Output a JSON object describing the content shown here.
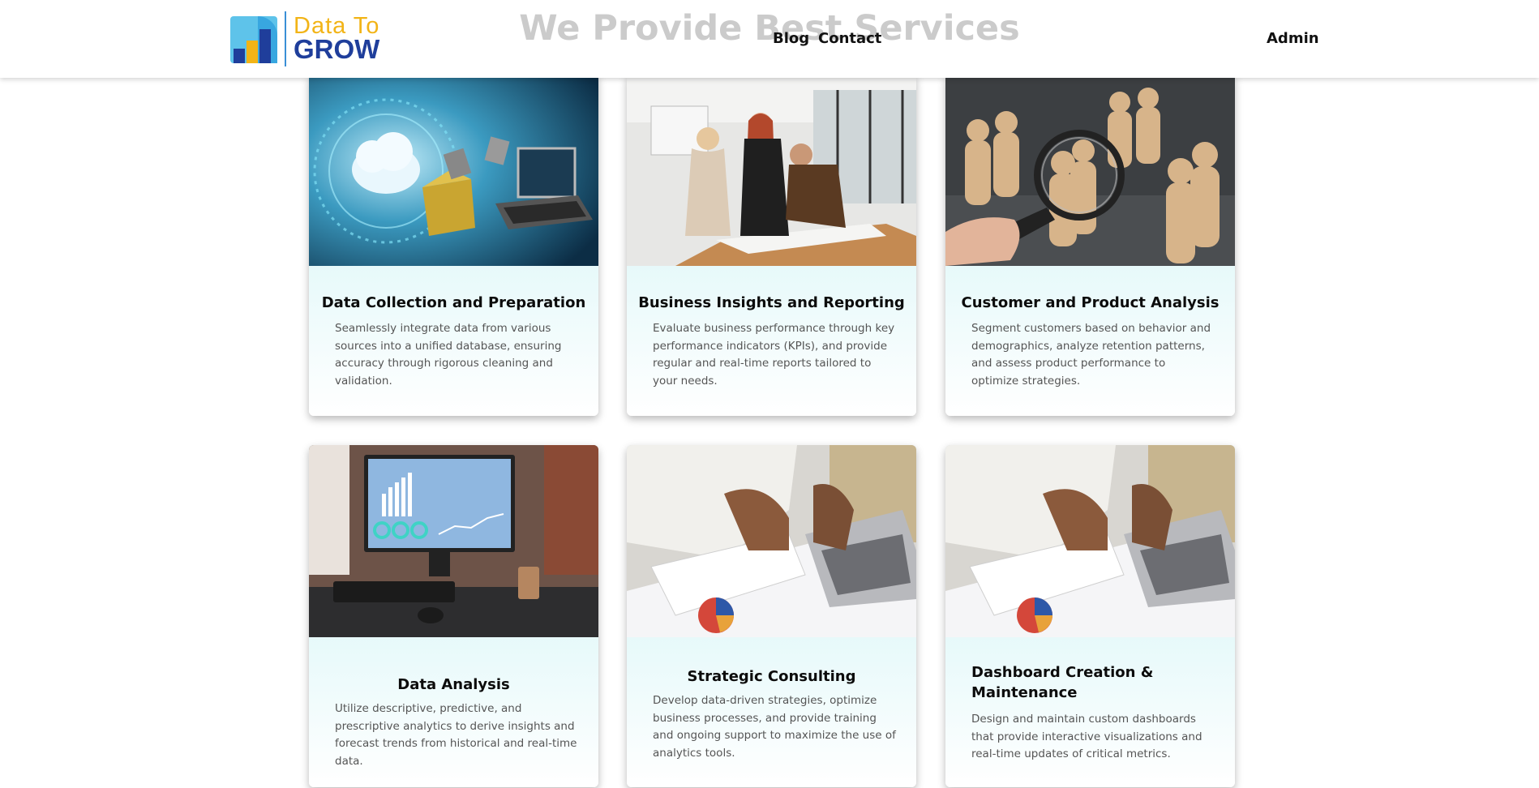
{
  "header": {
    "logo": {
      "line1": "Data To",
      "line2": "GROW"
    },
    "section_title": "We Provide Best Services",
    "nav": {
      "blog": "Blog",
      "contact": "Contact",
      "admin": "Admin"
    }
  },
  "services": [
    {
      "title": "Data Collection and Preparation",
      "description": "Seamlessly integrate data from various sources into a unified database, ensuring accuracy through rigorous cleaning and validation.",
      "image": "cloud-data-transfer-image"
    },
    {
      "title": "Business Insights and Reporting",
      "description": "Evaluate business performance through key performance indicators (KPIs), and provide regular and real-time reports tailored to your needs.",
      "image": "team-meeting-image"
    },
    {
      "title": "Customer and Product Analysis",
      "description": "Segment customers based on behavior and demographics, analyze retention patterns, and assess product performance to optimize strategies.",
      "image": "magnifier-figures-image"
    },
    {
      "title": "Data Analysis",
      "description": "Utilize descriptive, predictive, and prescriptive analytics to derive insights and forecast trends from historical and real-time data.",
      "image": "monitor-dashboard-image"
    },
    {
      "title": "Strategic Consulting",
      "description": "Develop data-driven strategies, optimize business processes, and provide training and ongoing support to maximize the use of analytics tools.",
      "image": "laptop-reports-image"
    },
    {
      "title": "Dashboard Creation & Maintenance",
      "description": "Design and maintain custom dashboards that provide interactive visualizations and real-time updates of critical metrics.",
      "image": "laptop-reports-image"
    }
  ],
  "colors": {
    "card_top": "#c8f1f2",
    "logo_yellow": "#f2b417",
    "logo_blue": "#1f3e9b",
    "accent": "#3a8fd6"
  }
}
